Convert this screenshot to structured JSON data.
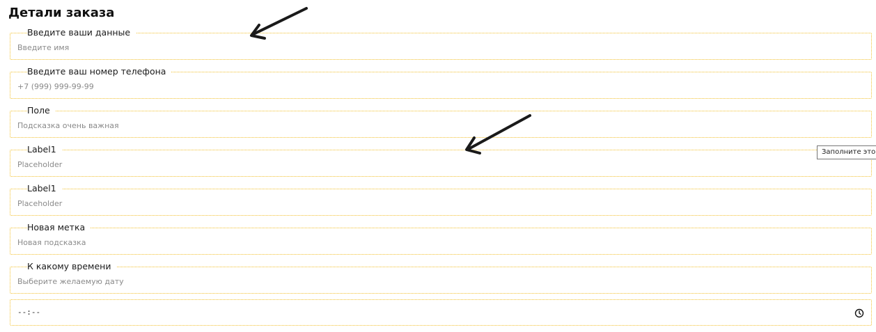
{
  "page": {
    "title": "Детали заказа"
  },
  "fields": [
    {
      "label": "Введите ваши данные",
      "placeholder": "Введите имя"
    },
    {
      "label": "Введите ваш номер телефона",
      "placeholder": "+7 (999) 999-99-99"
    },
    {
      "label": "Поле",
      "placeholder": "Подсказка очень важная"
    },
    {
      "label": "Label1",
      "placeholder": "Placeholder"
    },
    {
      "label": "Label1",
      "placeholder": "Placeholder"
    },
    {
      "label": "Новая метка",
      "placeholder": "Новая подсказка"
    },
    {
      "label": "К какому времени",
      "placeholder": "Выберите желаемую дату"
    }
  ],
  "time_input": {
    "value": "--:--",
    "icon": "clock-icon"
  },
  "tooltip": {
    "text": "Заполните это по"
  },
  "colors": {
    "field_border": "#f2c12e",
    "annotation_arrow": "#1a1a1a"
  }
}
